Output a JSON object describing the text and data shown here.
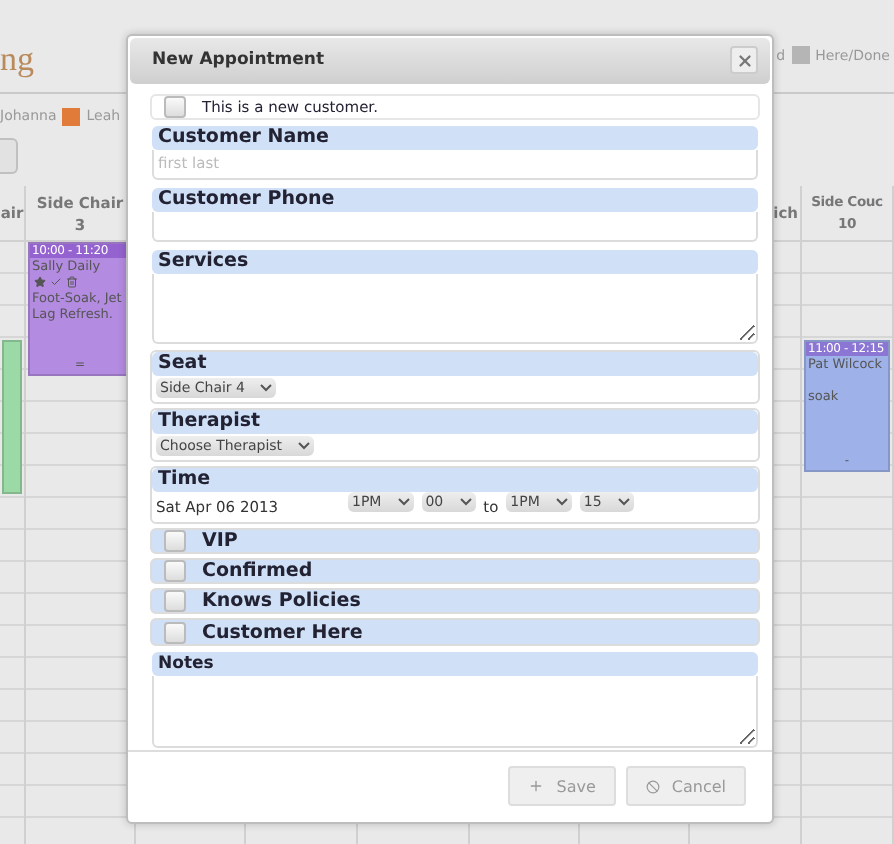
{
  "page": {
    "title": "ng",
    "legend": [
      {
        "label": "Johanna"
      },
      {
        "label": "Leah",
        "color": "#e07b39"
      },
      {
        "label": "d"
      },
      {
        "label": "Here/Done",
        "color": "#b5b5b5"
      }
    ]
  },
  "calendar": {
    "columns": [
      {
        "header": [
          "air"
        ],
        "events": [
          {
            "color": "#9bd9a6"
          }
        ]
      },
      {
        "header": [
          "Side Chair",
          "3"
        ],
        "events": [
          {
            "color": "#b38be0",
            "time": "10:00 - 11:20",
            "customer": "Sally Daily",
            "services": "Foot-Soak, Jet Lag Refresh.",
            "handle": "="
          }
        ]
      },
      {},
      {},
      {},
      {},
      {},
      {
        "header": [
          "ich"
        ]
      },
      {
        "header": [
          "Side Couc",
          "10"
        ],
        "events": [
          {
            "color": "#9eb1e8",
            "time": "11:00 - 12:15",
            "customer": "Pat Wilcock",
            "services": "soak",
            "handle": "-"
          }
        ]
      }
    ]
  },
  "dialog": {
    "title": "New Appointment",
    "new_customer": {
      "label": "This is a new customer.",
      "checked": false
    },
    "fields": [
      {
        "kind": "text",
        "label": "Customer Name",
        "placeholder": "first last"
      },
      {
        "kind": "text",
        "label": "Customer Phone"
      },
      {
        "kind": "textarea",
        "label": "Services"
      },
      {
        "kind": "select",
        "label": "Seat",
        "value": "Side Chair 4"
      },
      {
        "kind": "select",
        "label": "Therapist",
        "value": "Choose Therapist"
      },
      {
        "kind": "time",
        "label": "Time",
        "date": "Sat Apr 06 2013",
        "start_hour": "1PM",
        "start_minute": "00",
        "separator": "to",
        "end_hour": "1PM",
        "end_minute": "15"
      },
      {
        "kind": "checkbox",
        "label": "VIP",
        "checked": false
      },
      {
        "kind": "checkbox",
        "label": "Confirmed",
        "checked": false
      },
      {
        "kind": "checkbox",
        "label": "Knows Policies",
        "checked": false
      },
      {
        "kind": "checkbox",
        "label": "Customer Here",
        "checked": false
      },
      {
        "kind": "textarea",
        "label": "Notes"
      }
    ],
    "buttons": [
      {
        "kind": "save",
        "label": "Save"
      },
      {
        "kind": "cancel",
        "label": "Cancel"
      }
    ]
  }
}
